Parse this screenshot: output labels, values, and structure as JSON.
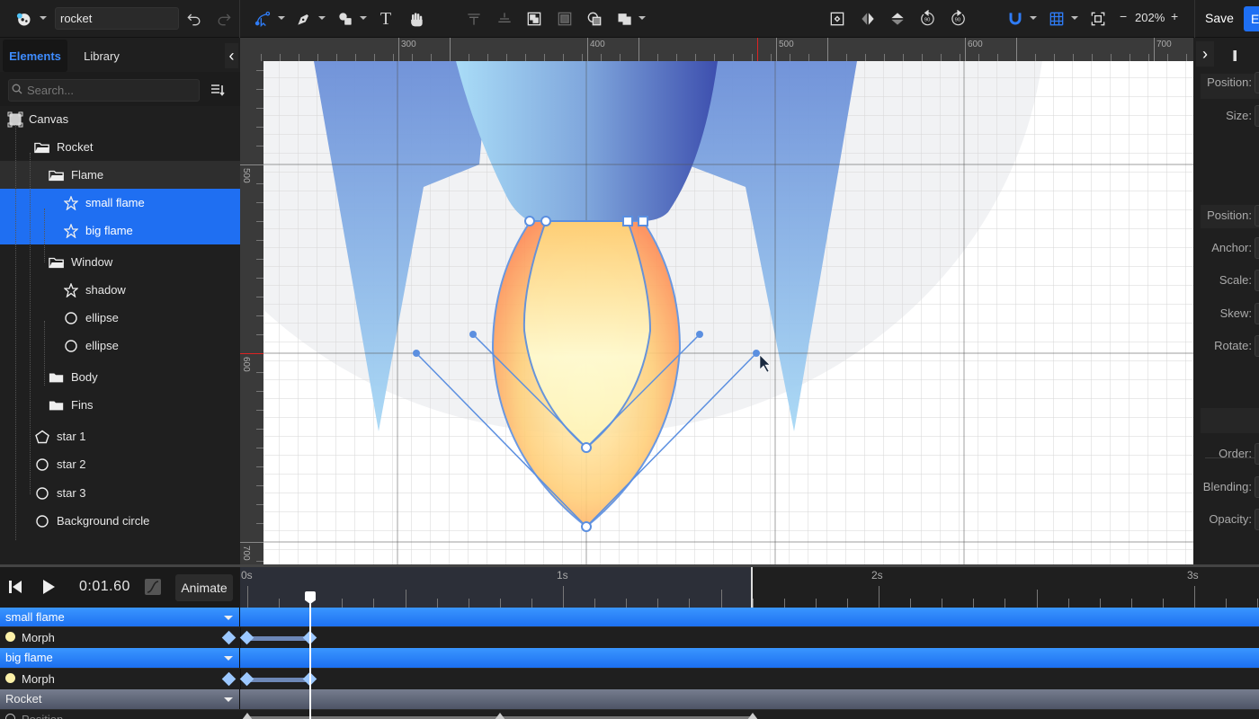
{
  "toolbar": {
    "app_menu_icon": "app-logo-icon",
    "document_name": "rocket",
    "undo_icon": "undo-icon",
    "redo_icon": "redo-icon",
    "tools": [
      {
        "name": "node-tool",
        "icon": "node-select-icon",
        "active": true
      },
      {
        "name": "pen-tool",
        "icon": "pen-icon"
      },
      {
        "name": "shape-tool",
        "icon": "shapes-icon"
      },
      {
        "name": "text-tool",
        "icon": "text-icon"
      },
      {
        "name": "hand-tool",
        "icon": "hand-icon"
      }
    ],
    "zoom_level": "202%",
    "zoom_minus": "−",
    "zoom_plus": "+",
    "save_label": "Save",
    "export_label": "E"
  },
  "left_panel": {
    "tabs": [
      {
        "label": "Elements",
        "active": true
      },
      {
        "label": "Library",
        "active": false
      }
    ],
    "search_placeholder": "Search...",
    "tree": [
      {
        "label": "Canvas",
        "icon": "artboard-icon",
        "depth": 0
      },
      {
        "label": "Rocket",
        "icon": "folder-open-icon",
        "depth": 1
      },
      {
        "label": "Flame",
        "icon": "folder-open-icon",
        "depth": 2,
        "highlighted": true
      },
      {
        "label": "small flame",
        "icon": "star-outline-icon",
        "depth": 3,
        "selected": true
      },
      {
        "label": "big flame",
        "icon": "star-outline-icon",
        "depth": 3,
        "selected": true
      },
      {
        "label": "Window",
        "icon": "folder-open-icon",
        "depth": 2
      },
      {
        "label": "shadow",
        "icon": "star-outline-icon",
        "depth": 3
      },
      {
        "label": "ellipse",
        "icon": "circle-icon",
        "depth": 3
      },
      {
        "label": "ellipse",
        "icon": "circle-icon",
        "depth": 3
      },
      {
        "label": "Body",
        "icon": "folder-icon",
        "depth": 2
      },
      {
        "label": "Fins",
        "icon": "folder-icon",
        "depth": 2
      },
      {
        "label": "star 1",
        "icon": "pentagon-icon",
        "depth": 1
      },
      {
        "label": "star 2",
        "icon": "circle-icon",
        "depth": 1
      },
      {
        "label": "star 3",
        "icon": "circle-icon",
        "depth": 1
      },
      {
        "label": "Background circle",
        "icon": "circle-icon",
        "depth": 1
      }
    ]
  },
  "rulers": {
    "horizontal": [
      "300",
      "400",
      "500",
      "600",
      "700"
    ],
    "vertical": [
      "500",
      "600",
      "700"
    ]
  },
  "right_panel": {
    "labels": [
      "Position:",
      "Size:",
      "Position:",
      "Anchor:",
      "Scale:",
      "Skew:",
      "Rotate:",
      "Order:",
      "Blending:",
      "Opacity:"
    ]
  },
  "timeline": {
    "current_time": "0:01.60",
    "animate_label": "Animate",
    "time_labels": [
      "0s",
      "1s",
      "2s",
      "3s"
    ],
    "tracks": [
      {
        "type": "group",
        "label": "small flame",
        "color": "blue"
      },
      {
        "type": "property",
        "label": "Morph"
      },
      {
        "type": "group",
        "label": "big flame",
        "color": "blue"
      },
      {
        "type": "property",
        "label": "Morph"
      },
      {
        "type": "group",
        "label": "Rocket",
        "color": "grey"
      },
      {
        "type": "property",
        "label": "Position"
      }
    ]
  },
  "colors": {
    "accent": "#1f6ff2",
    "selection_stroke": "#5b8fe0",
    "flame_outer": "#ff9a5a",
    "flame_inner": "#fffbd0"
  }
}
